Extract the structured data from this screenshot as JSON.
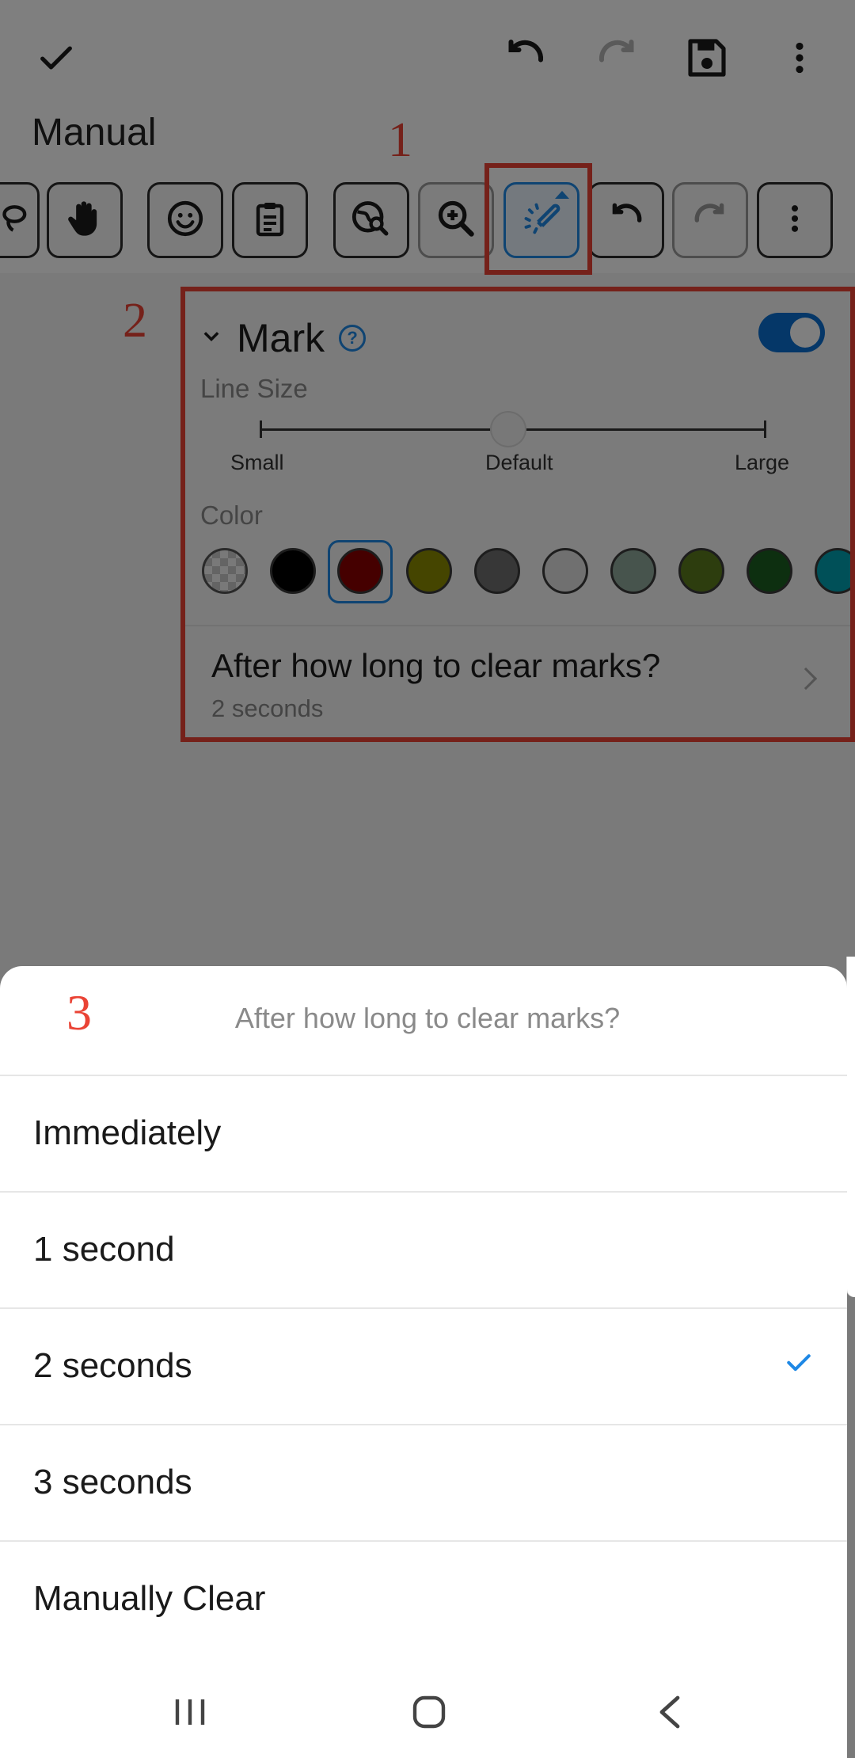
{
  "top_bar": {
    "confirm_icon": "check-icon",
    "undo_icon": "undo-icon",
    "redo_icon": "redo-icon",
    "save_icon": "save-icon",
    "more_icon": "more-vert-icon"
  },
  "document": {
    "title": "Manual"
  },
  "tool_strip": {
    "tools": [
      {
        "name": "lasso-tool",
        "icon": "lasso-icon"
      },
      {
        "name": "pan-tool",
        "icon": "hand-icon"
      },
      {
        "name": "sticker-tool",
        "icon": "smiley-icon"
      },
      {
        "name": "clipboard-tool",
        "icon": "clipboard-icon"
      },
      {
        "name": "search-tool",
        "icon": "search-globe-icon"
      },
      {
        "name": "zoom-tool",
        "icon": "zoom-in-icon"
      },
      {
        "name": "mark-tool",
        "icon": "laser-pen-icon",
        "active": true
      },
      {
        "name": "undo-tool",
        "icon": "undo-icon"
      },
      {
        "name": "redo-tool",
        "icon": "redo-icon"
      },
      {
        "name": "more-tool",
        "icon": "more-vert-icon"
      }
    ]
  },
  "annotations": {
    "one": "1",
    "two": "2",
    "three": "3"
  },
  "mark_panel": {
    "title": "Mark",
    "enabled": true,
    "line_size_label": "Line Size",
    "size_small": "Small",
    "size_default": "Default",
    "size_large": "Large",
    "line_size_position": "Default",
    "color_label": "Color",
    "colors": [
      "#000000",
      "#8b0000",
      "#8b8b00",
      "#6e6e6e",
      "#e0e0e0",
      "#8fa89a",
      "#5b7a1c",
      "#1b5e20",
      "#00a0b0"
    ],
    "selected_color": "#8b0000",
    "clear_marks_title": "After how long to clear marks?",
    "clear_marks_value": "2 seconds"
  },
  "sheet": {
    "title": "After how long to clear marks?",
    "options": [
      "Immediately",
      "1 second",
      "2 seconds",
      "3 seconds",
      "Manually Clear"
    ],
    "selected": "2 seconds"
  },
  "nav": {
    "recents_icon": "recents-icon",
    "home_icon": "home-icon",
    "back_icon": "back-icon"
  },
  "colors": {
    "accent": "#1e88e5",
    "annotation": "#ea4335",
    "toggle": "#0b6fd0"
  }
}
